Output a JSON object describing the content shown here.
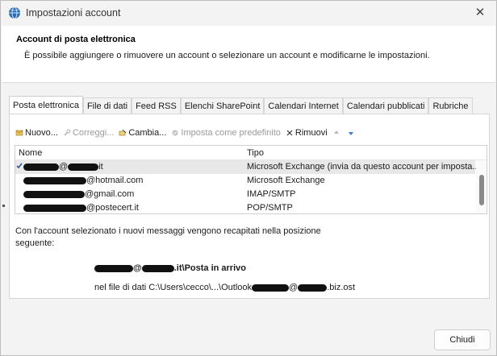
{
  "window": {
    "title": "Impostazioni account",
    "close_glyph": "✕"
  },
  "header": {
    "title": "Account di posta elettronica",
    "subtitle": "È possibile aggiungere o rimuovere un account o selezionare un account e modificarne le impostazioni."
  },
  "tabs": [
    {
      "label": "Posta elettronica",
      "active": true
    },
    {
      "label": "File di dati"
    },
    {
      "label": "Feed RSS"
    },
    {
      "label": "Elenchi SharePoint"
    },
    {
      "label": "Calendari Internet"
    },
    {
      "label": "Calendari pubblicati"
    },
    {
      "label": "Rubriche"
    }
  ],
  "toolbar": {
    "new_label": "Nuovo...",
    "repair_label": "Correggi...",
    "change_label": "Cambia...",
    "default_label": "Imposta come predefinito",
    "remove_label": "Rimuovi"
  },
  "list": {
    "col_name": "Nome",
    "col_type": "Tipo",
    "rows": [
      {
        "name_suffix": "it",
        "name_mid": "@",
        "type": "Microsoft Exchange (invia da questo account per imposta...",
        "selected": true
      },
      {
        "name_suffix": "@hotmail.com",
        "type": "Microsoft Exchange"
      },
      {
        "name_suffix": "@gmail.com",
        "type": "IMAP/SMTP"
      },
      {
        "name_suffix": "@postecert.it",
        "type": "POP/SMTP"
      }
    ]
  },
  "info": {
    "text": "Con l'account selezionato i nuovi messaggi vengono recapitati nella posizione seguente:",
    "dest_at": "@",
    "dest_suffix": ".it\\Posta in arrivo",
    "file_prefix": "nel file di dati C:\\Users\\cecco\\...\\Outlook",
    "file_at": "@",
    "file_suffix": ".biz.ost"
  },
  "footer": {
    "close_label": "Chiudi"
  },
  "colors": {
    "accent": "#1f4e9c",
    "selected_row": "#e8e8e8"
  }
}
